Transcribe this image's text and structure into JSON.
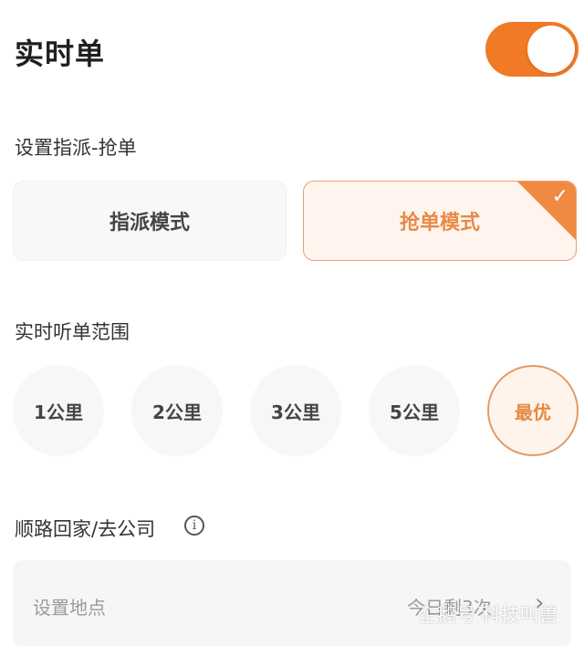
{
  "header": {
    "title": "实时单",
    "toggle_on": true
  },
  "dispatch": {
    "label": "设置指派-抢单",
    "options": [
      {
        "label": "指派模式",
        "selected": false
      },
      {
        "label": "抢单模式",
        "selected": true
      }
    ]
  },
  "range": {
    "label": "实时听单范围",
    "options": [
      {
        "label": "1公里",
        "selected": false
      },
      {
        "label": "2公里",
        "selected": false
      },
      {
        "label": "3公里",
        "selected": false
      },
      {
        "label": "5公里",
        "selected": false
      },
      {
        "label": "最优",
        "selected": true
      }
    ]
  },
  "route": {
    "label": "顺路回家/去公司",
    "info_icon": "i",
    "placeholder": "设置地点",
    "remaining": "今日剩3次",
    "chevron": "›"
  },
  "watermark": "企鹅号 科技叫兽",
  "colors": {
    "accent": "#f07a25",
    "accent_text": "#e58a44",
    "selected_bg": "#fff5ee"
  }
}
